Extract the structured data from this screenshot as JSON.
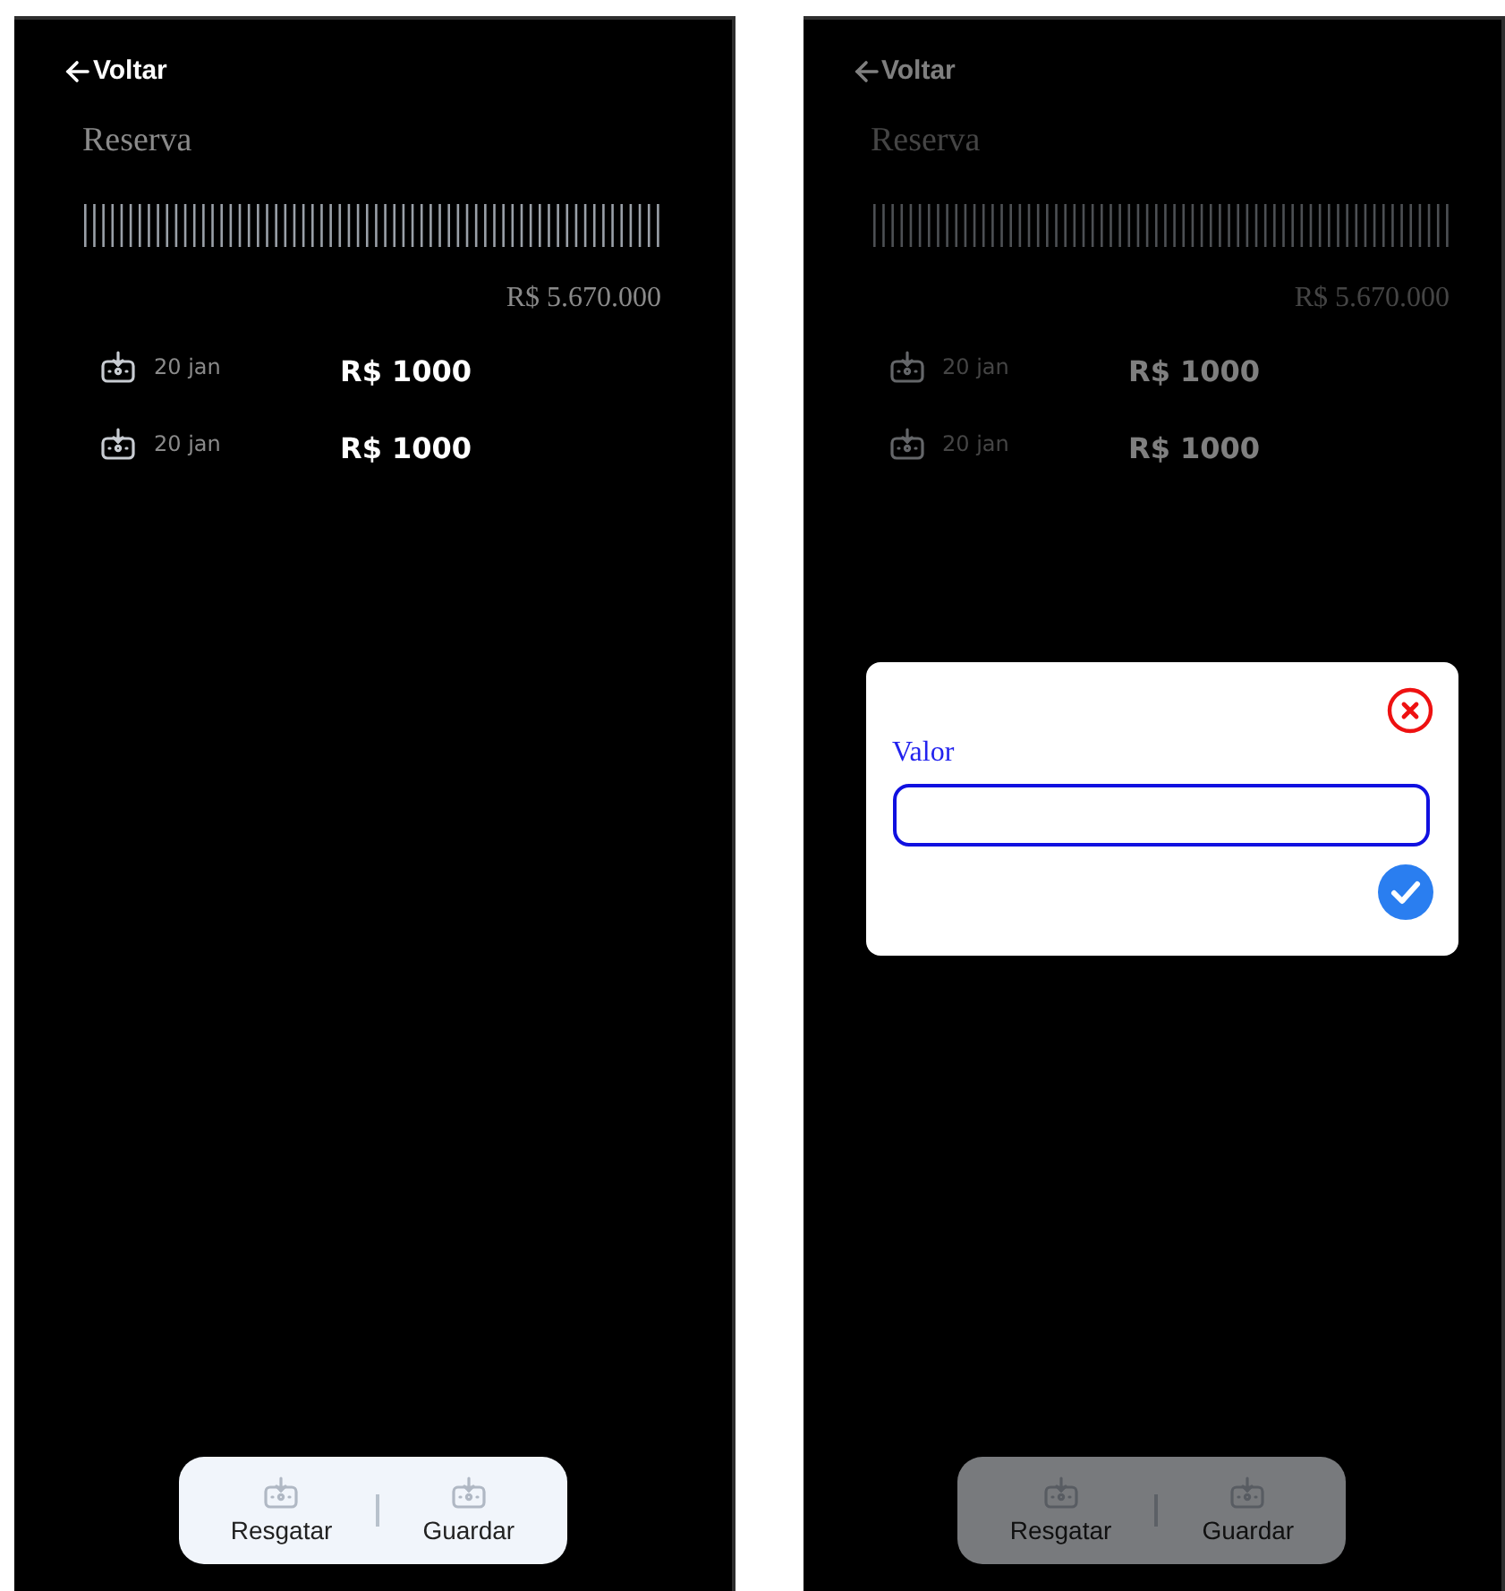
{
  "screens": [
    {
      "back": "Voltar",
      "title": "Reserva",
      "total": "R$ 5.670.000",
      "transactions": [
        {
          "date": "20 jan",
          "amount": "R$ 1000"
        },
        {
          "date": "20 jan",
          "amount": "R$ 1000"
        }
      ],
      "actions": [
        {
          "label": "Resgatar"
        },
        {
          "label": "Guardar"
        }
      ],
      "modal": {
        "open": false
      }
    },
    {
      "back": "Voltar",
      "title": "Reserva",
      "total": "R$ 5.670.000",
      "transactions": [
        {
          "date": "20 jan",
          "amount": "R$ 1000"
        },
        {
          "date": "20 jan",
          "amount": "R$ 1000"
        }
      ],
      "actions": [
        {
          "label": "Resgatar"
        },
        {
          "label": "Guardar"
        }
      ],
      "modal": {
        "open": true,
        "label": "Valor"
      }
    }
  ]
}
